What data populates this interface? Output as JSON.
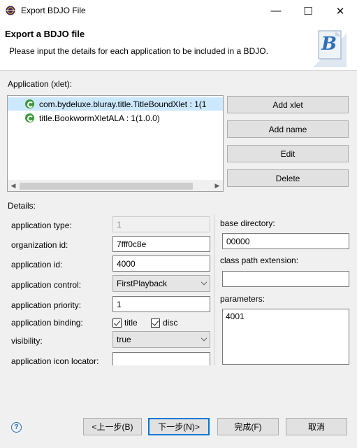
{
  "window": {
    "title": "Export BDJO File",
    "minimize_glyph": "—",
    "maximize_glyph": "☐",
    "close_glyph": "✕"
  },
  "header": {
    "title": "Export a BDJO file",
    "description": "Please input the details for each application to be included in a BDJO.",
    "banner_letter": "B"
  },
  "applications": {
    "label": "Application (xlet):",
    "items": [
      {
        "text": "com.bydeluxe.bluray.title.TitleBoundXlet :  1(1",
        "selected": true
      },
      {
        "text": "title.BookwormXletALA :  1(1.0.0)",
        "selected": false
      }
    ],
    "scroll_left": "◀",
    "scroll_right": "▶"
  },
  "side_buttons": {
    "add_xlet": "Add xlet",
    "add_name": "Add name",
    "edit": "Edit",
    "delete": "Delete"
  },
  "details": {
    "label": "Details:",
    "application_type_label": "application type:",
    "application_type_value": "1",
    "organization_id_label": "organization id:",
    "organization_id_value": "7fff0c8e",
    "application_id_label": "application id:",
    "application_id_value": "4000",
    "application_control_label": "application control:",
    "application_control_value": "FirstPlayback",
    "application_priority_label": "application priority:",
    "application_priority_value": "1",
    "application_binding_label": "application binding:",
    "binding_title_label": "title",
    "binding_title_checked": true,
    "binding_disc_label": "disc",
    "binding_disc_checked": true,
    "visibility_label": "visibility:",
    "visibility_value": "true",
    "icon_locator_label": "application icon locator:",
    "icon_locator_value": ""
  },
  "right_panel": {
    "base_directory_label": "base directory:",
    "base_directory_value": "00000",
    "class_path_label": "class path extension:",
    "class_path_value": "",
    "parameters_label": "parameters:",
    "parameters_value": "4001"
  },
  "footer": {
    "help_glyph": "?",
    "back": "<上一步(B)",
    "next": "下一步(N)>",
    "finish": "完成(F)",
    "cancel": "取消"
  },
  "colors": {
    "selection": "#cce8ff",
    "accent": "#0078d7",
    "xlet_icon": "#3c9a3c"
  }
}
